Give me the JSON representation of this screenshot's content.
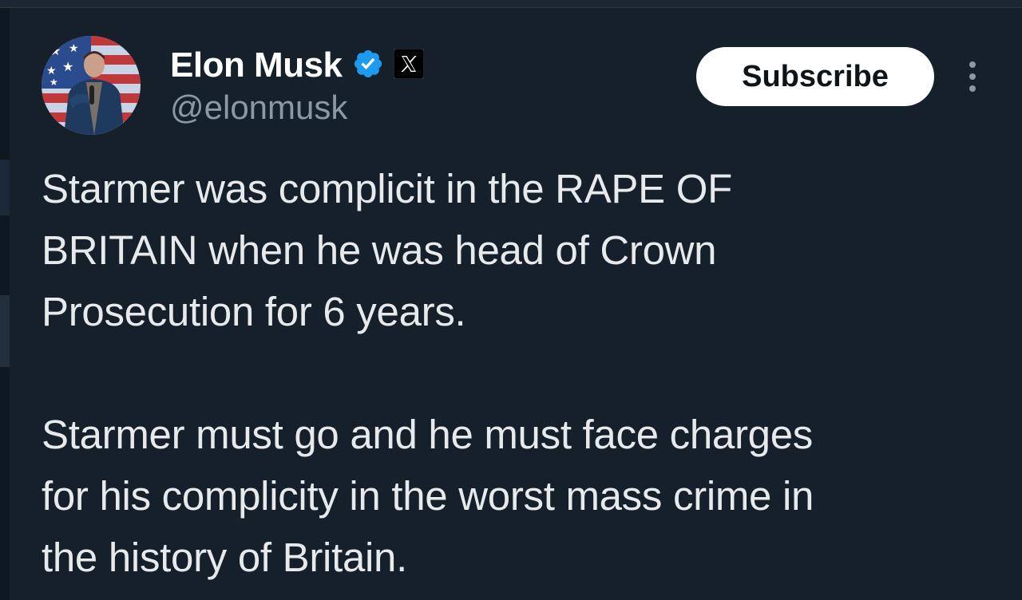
{
  "author": {
    "display_name": "Elon Musk",
    "handle": "@elonmusk",
    "verified_icon": "verified-badge-icon",
    "affiliation_icon": "x-logo-icon",
    "avatar_icon": "profile-photo"
  },
  "actions": {
    "subscribe_label": "Subscribe",
    "more_icon": "more-vertical-icon"
  },
  "tweet": {
    "paragraphs": [
      "Starmer was complicit in the RAPE OF\nBRITAIN when he was head of Crown\nProsecution for 6 years.",
      "Starmer must go and he must face charges\nfor his complicity in the worst mass crime in\nthe history of Britain."
    ]
  },
  "colors": {
    "background": "#15202b",
    "text": "#e7e9ea",
    "secondary_text": "#8b98a5",
    "verified_blue": "#1d9bf0",
    "button_bg": "#ffffff",
    "button_text": "#0f1419"
  }
}
